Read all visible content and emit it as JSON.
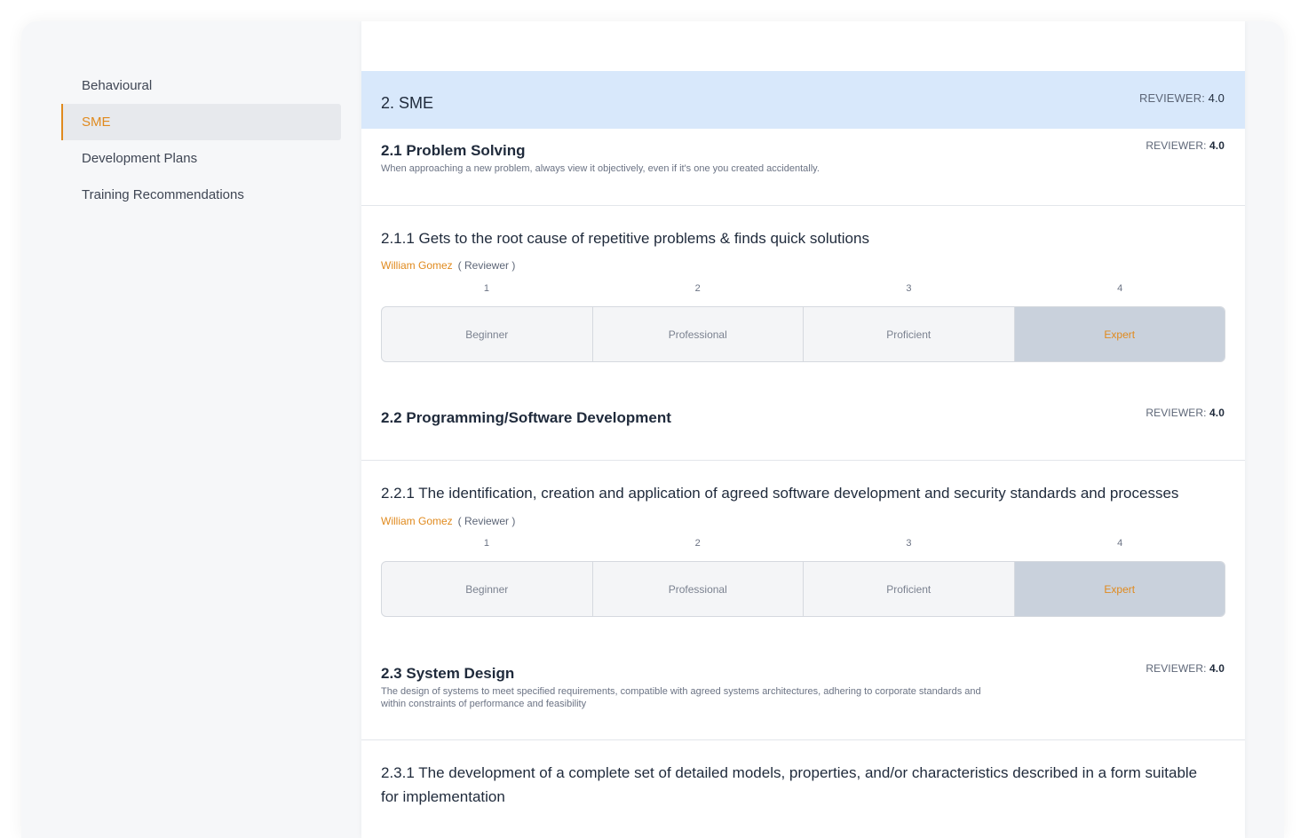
{
  "sidebar": {
    "items": [
      {
        "label": "Behavioural"
      },
      {
        "label": "SME"
      },
      {
        "label": "Development Plans"
      },
      {
        "label": "Training Recommendations"
      }
    ],
    "active_index": 1
  },
  "section": {
    "title": "2. SME",
    "reviewer_label": "REVIEWER:",
    "reviewer_value": "4.0"
  },
  "topics": [
    {
      "title": "2.1 Problem Solving",
      "description": "When approaching a new problem, always view it objectively, even if it's one you created accidentally.",
      "reviewer_label": "REVIEWER:",
      "reviewer_value": "4.0"
    },
    {
      "title": "2.2 Programming/Software Development",
      "description": "",
      "reviewer_label": "REVIEWER:",
      "reviewer_value": "4.0"
    },
    {
      "title": "2.3 System Design",
      "description": "The design of systems to meet specified requirements, compatible with agreed systems architectures, adhering to corporate standards and within constraints of performance and feasibility",
      "reviewer_label": "REVIEWER:",
      "reviewer_value": "4.0"
    }
  ],
  "criteria": [
    {
      "title": "2.1.1 Gets to the root cause of repetitive problems & finds quick solutions",
      "rater_name": "William Gomez",
      "rater_role": "( Reviewer )",
      "selected": 4
    },
    {
      "title": "2.2.1 The identification, creation and application of agreed software development and security standards and processes",
      "rater_name": "William Gomez",
      "rater_role": "( Reviewer )",
      "selected": 4
    },
    {
      "title": "2.3.1 The development of a complete set of detailed models, properties, and/or characteristics described in a form suitable for implementation"
    }
  ],
  "scale": {
    "numbers": [
      "1",
      "2",
      "3",
      "4"
    ],
    "levels": [
      "Beginner",
      "Professional",
      "Proficient",
      "Expert"
    ]
  },
  "colors": {
    "accent": "#e08a1e",
    "section_header_bg": "#d8e8fb",
    "selected_level_bg": "#c9d1dc"
  }
}
